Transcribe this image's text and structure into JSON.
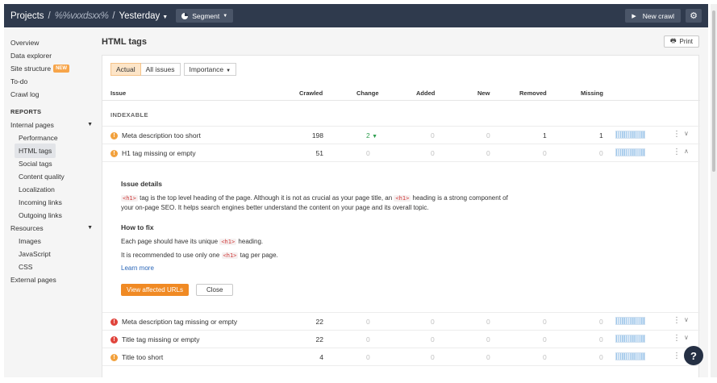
{
  "topbar": {
    "projects": "Projects",
    "project_name": "%%vxxdsxx%",
    "date": "Yesterday",
    "segment": "Segment",
    "new_crawl": "New crawl"
  },
  "sidebar": {
    "items_top": [
      {
        "label": "Overview"
      },
      {
        "label": "Data explorer"
      },
      {
        "label": "Site structure",
        "badge": "NEW"
      },
      {
        "label": "To-do"
      },
      {
        "label": "Crawl log"
      }
    ],
    "reports_heading": "REPORTS",
    "internal_pages": "Internal pages",
    "internal_sub": [
      "Performance",
      "HTML tags",
      "Social tags",
      "Content quality",
      "Localization",
      "Incoming links",
      "Outgoing links"
    ],
    "resources": "Resources",
    "resources_sub": [
      "Images",
      "JavaScript",
      "CSS"
    ],
    "external_pages": "External pages"
  },
  "main": {
    "title": "HTML tags",
    "print": "Print",
    "tabs": [
      "Actual",
      "All issues"
    ],
    "importance": "Importance",
    "columns": [
      "Issue",
      "Crawled",
      "Change",
      "Added",
      "New",
      "Removed",
      "Missing"
    ],
    "group": "INDEXABLE",
    "rows": [
      {
        "issue": "Meta description too short",
        "level": "warning",
        "crawled": "198",
        "change": "2",
        "added": "0",
        "new": "0",
        "removed": "1",
        "missing": "1"
      },
      {
        "issue": "H1 tag missing or empty",
        "level": "warning",
        "crawled": "51",
        "change": "0",
        "added": "0",
        "new": "0",
        "removed": "0",
        "missing": "0"
      },
      {
        "issue": "Meta description tag missing or empty",
        "level": "error",
        "crawled": "22",
        "change": "0",
        "added": "0",
        "new": "0",
        "removed": "0",
        "missing": "0"
      },
      {
        "issue": "Title tag missing or empty",
        "level": "error",
        "crawled": "22",
        "change": "0",
        "added": "0",
        "new": "0",
        "removed": "0",
        "missing": "0"
      },
      {
        "issue": "Title too short",
        "level": "warning",
        "crawled": "4",
        "change": "0",
        "added": "0",
        "new": "0",
        "removed": "0",
        "missing": "0"
      }
    ],
    "details": {
      "heading": "Issue details",
      "tag": "<h1>",
      "p1_a": "tag is the top level heading of the page. Although it is not as crucial as your page title, an",
      "p1_b": "heading is a strong component of",
      "p1_c": "your on-page SEO. It helps search engines better understand the content on your page and its overall topic.",
      "howto": "How to fix",
      "fix1_a": "Each page should have its unique",
      "fix1_b": "heading.",
      "fix2_a": "It is recommended to use only one",
      "fix2_b": "tag per page.",
      "learn_more": "Learn more",
      "view_urls": "View affected URLs",
      "close": "Close"
    }
  },
  "help": "?"
}
